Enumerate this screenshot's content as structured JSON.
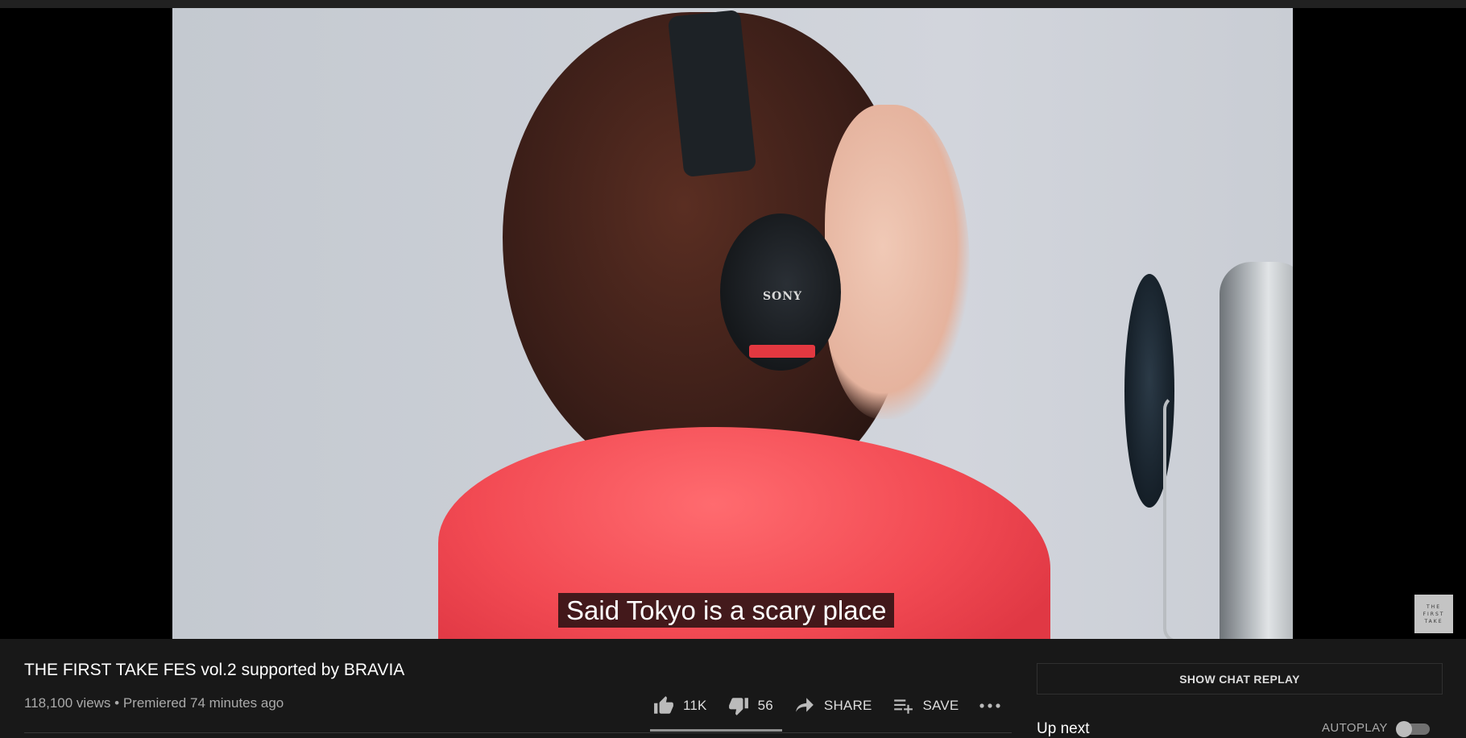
{
  "video": {
    "caption": "Said Tokyo is a scary place",
    "headphone_brand": "SONY",
    "watermark": "THE FIRST TAKE"
  },
  "info": {
    "title": "THE FIRST TAKE FES vol.2 supported by BRAVIA",
    "views": "118,100 views",
    "separator": "•",
    "premiered": "Premiered 74 minutes ago"
  },
  "actions": {
    "like_count": "11K",
    "dislike_count": "56",
    "share_label": "SHARE",
    "save_label": "SAVE",
    "like_ratio": 0.995
  },
  "sidebar": {
    "chat_replay_label": "SHOW CHAT REPLAY",
    "up_next_label": "Up next",
    "autoplay_label": "AUTOPLAY",
    "autoplay_on": false
  },
  "icons": {
    "like": "thumbs-up-icon",
    "dislike": "thumbs-down-icon",
    "share": "share-arrow-icon",
    "save": "playlist-add-icon",
    "more": "more-horizontal-icon"
  },
  "colors": {
    "background": "#181818",
    "text_primary": "#ffffff",
    "text_secondary": "#aaaaaa",
    "shirt": "#f24a53"
  }
}
